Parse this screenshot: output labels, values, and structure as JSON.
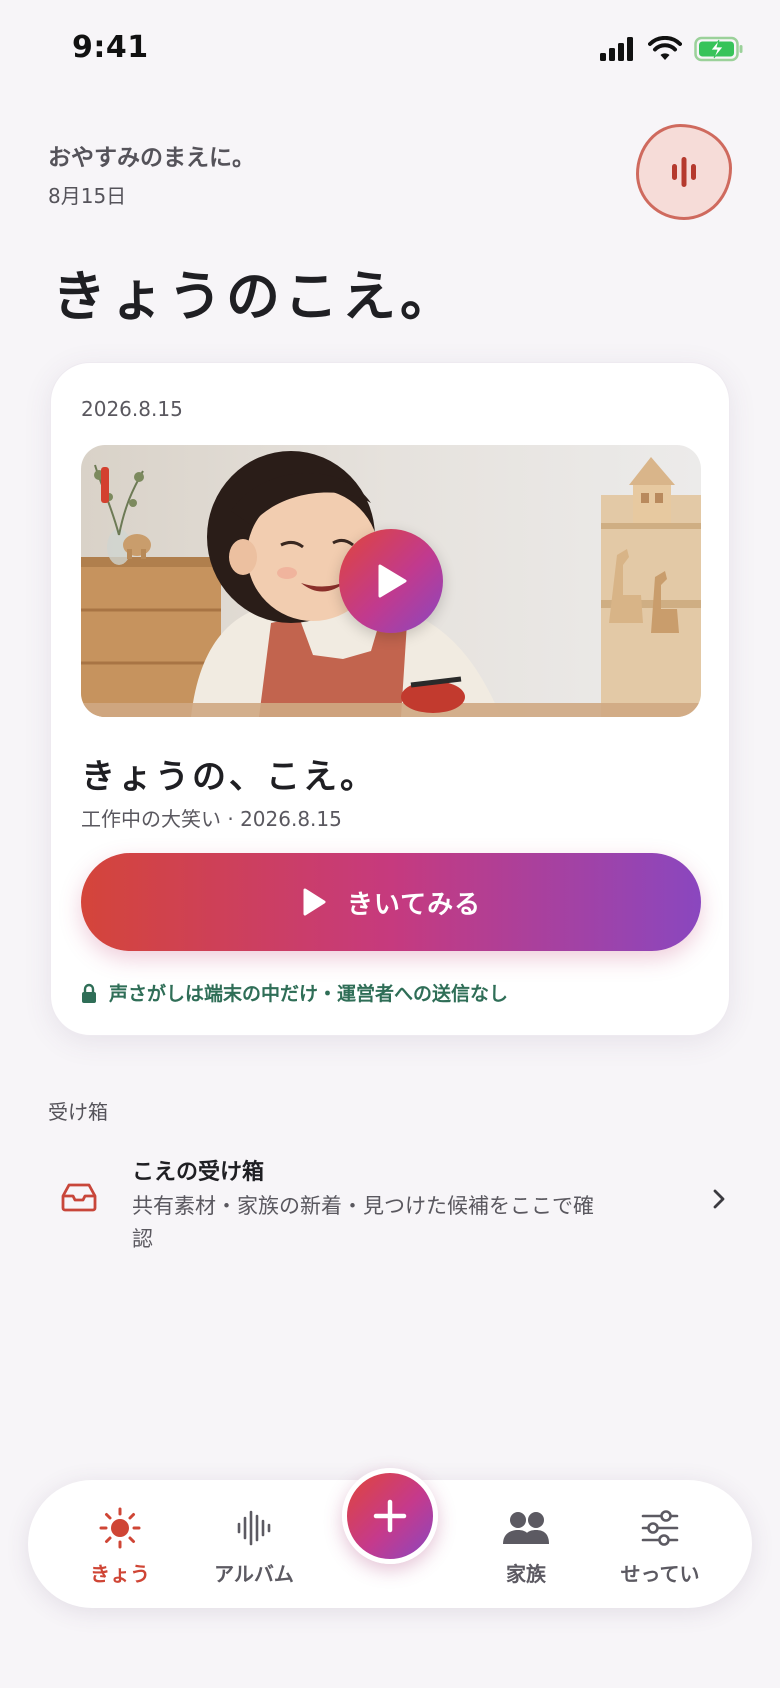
{
  "status_bar": {
    "time": "9:41"
  },
  "header": {
    "greeting": "おやすみのまえに。",
    "date": "8月15日",
    "title": "きょうのこえ。"
  },
  "card": {
    "date": "2026.8.15",
    "title": "きょうの、こえ。",
    "subtitle": "工作中の大笑い · 2026.8.15",
    "listen_label": "きいてみる",
    "privacy_note": "声さがしは端末の中だけ・運営者への送信なし"
  },
  "inbox": {
    "section_label": "受け箱",
    "title": "こえの受け箱",
    "description": "共有素材・家族の新着・見つけた候補をここで確認"
  },
  "tabs": [
    {
      "label": "きょう",
      "icon": "sun-icon",
      "active": true
    },
    {
      "label": "アルバム",
      "icon": "waveform-icon",
      "active": false
    },
    {
      "label": "家族",
      "icon": "people-icon",
      "active": false
    },
    {
      "label": "せってい",
      "icon": "sliders-icon",
      "active": false
    }
  ],
  "colors": {
    "accent": "#cf4535",
    "gradient_start": "#d4453a",
    "gradient_mid": "#c63a7e",
    "gradient_end": "#8a47bf",
    "privacy_green": "#2f6e57",
    "background": "#f7f5f8"
  }
}
